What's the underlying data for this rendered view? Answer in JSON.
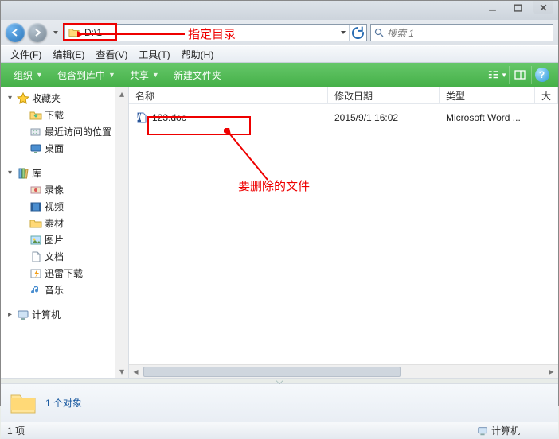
{
  "titlebar": {},
  "nav": {
    "path": "D:\\1",
    "search_placeholder": "搜索 1"
  },
  "menus": {
    "file": "文件(F)",
    "edit": "编辑(E)",
    "view": "查看(V)",
    "tools": "工具(T)",
    "help": "帮助(H)"
  },
  "toolbar": {
    "organize": "组织",
    "include": "包含到库中",
    "share": "共享",
    "newfolder": "新建文件夹"
  },
  "sidebar": {
    "fav": "收藏夹",
    "fav_items": [
      "下载",
      "最近访问的位置",
      "桌面"
    ],
    "lib": "库",
    "lib_items": [
      "录像",
      "视频",
      "素材",
      "图片",
      "文档",
      "迅雷下载",
      "音乐"
    ],
    "computer": "计算机"
  },
  "columns": {
    "name": "名称",
    "date": "修改日期",
    "type": "类型",
    "size": "大"
  },
  "files": [
    {
      "name": "123.doc",
      "date": "2015/9/1 16:02",
      "type": "Microsoft Word ..."
    }
  ],
  "details": {
    "count": "1 个对象"
  },
  "status": {
    "items": "1 项",
    "location": "计算机"
  },
  "annotations": {
    "addr_label": "指定目录",
    "file_label": "要删除的文件"
  }
}
